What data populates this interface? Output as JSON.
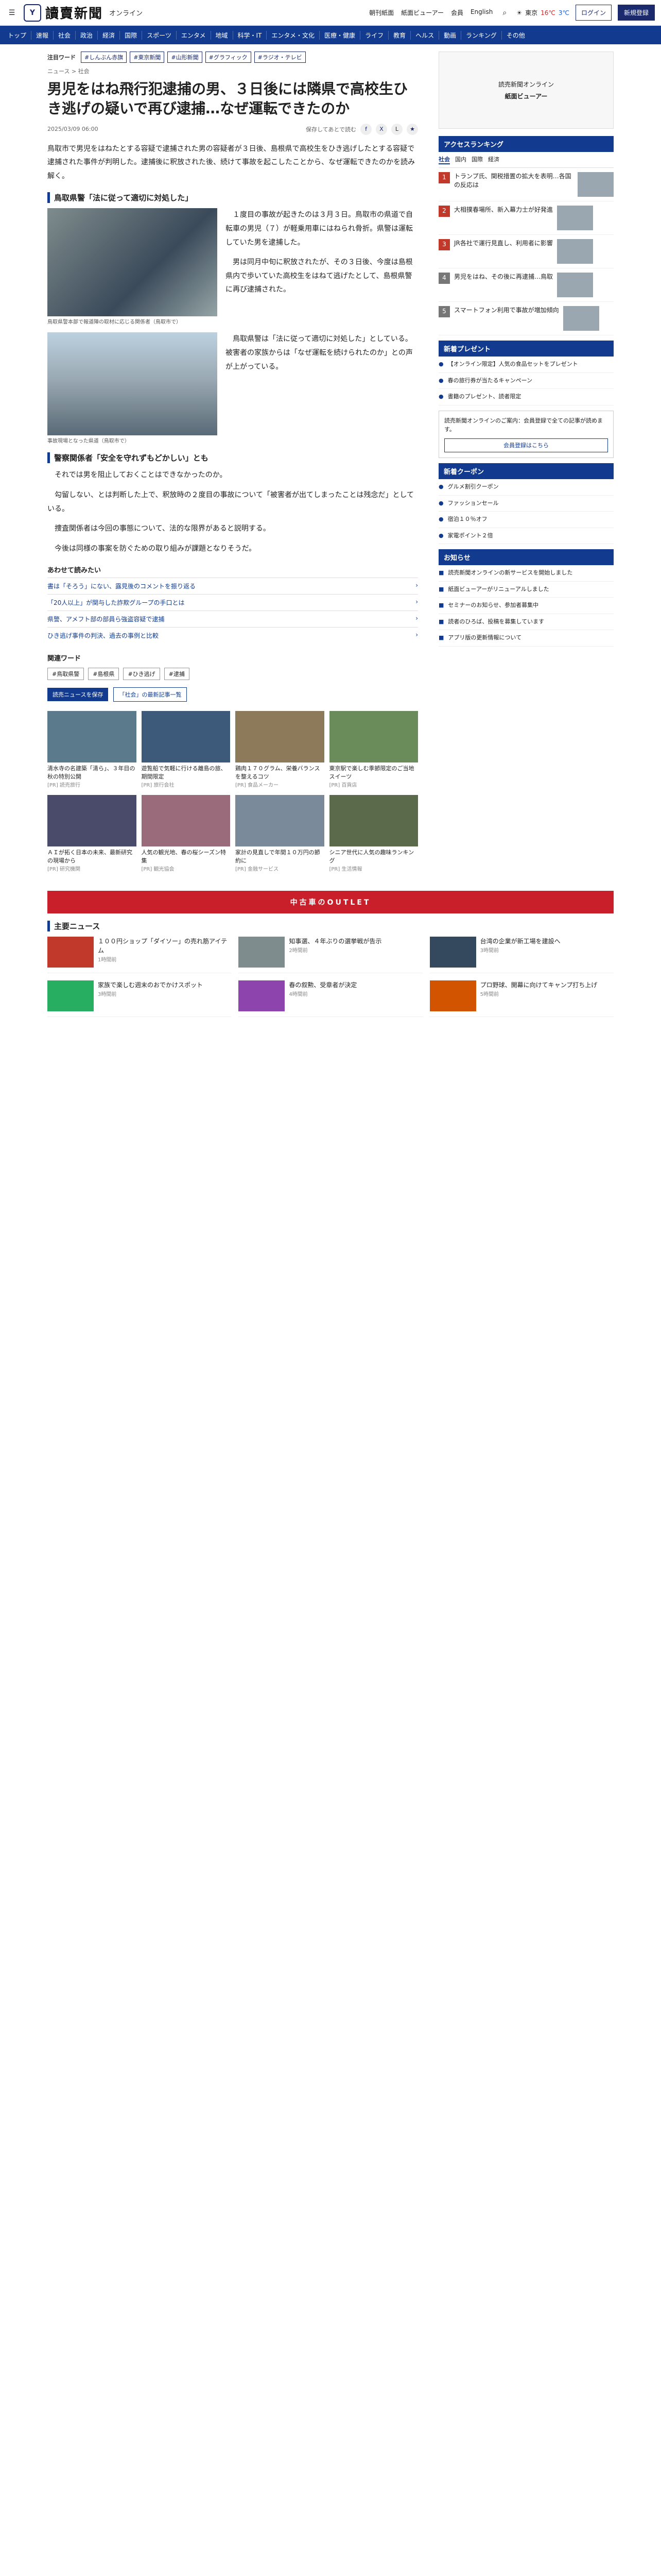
{
  "header": {
    "logo_mark": "Y",
    "logo_text": "讀賣新聞",
    "logo_sub": "オンライン",
    "util_links": [
      "朝刊紙面",
      "紙面ビューアー",
      "会員",
      "English"
    ],
    "weather": {
      "hi": "16℃",
      "lo": "3℃",
      "city": "東京"
    },
    "login": "ログイン",
    "register": "新規登録"
  },
  "nav": [
    "トップ",
    "速報",
    "社会",
    "政治",
    "経済",
    "国際",
    "スポーツ",
    "エンタメ",
    "地域",
    "科学・IT",
    "エンタメ・文化",
    "医療・健康",
    "ライフ",
    "教育",
    "ヘルス",
    "動画",
    "ランキング",
    "その他"
  ],
  "article": {
    "tags_label": "注目ワード",
    "tags": [
      "#しんぶん赤旗",
      "#東京新聞",
      "#山形新聞",
      "#グラフィック",
      "#ラジオ・テレビ"
    ],
    "crumb": "ニュース > 社会",
    "headline": "男児をはね飛行犯逮捕の男、３日後には隣県で高校生ひき逃げの疑いで再び逮捕…なぜ運転できたのか",
    "date": "2025/03/09 06:00",
    "share_label": "保存してあとで読む",
    "lead": "鳥取市で男児をはねたとする容疑で逮捕された男の容疑者が３日後、島根県で高校生をひき逃げしたとする容疑で逮捕された事件が判明した。逮捕後に釈放された後、続けて事故を起こしたことから、なぜ運転できたのかを読み解く。",
    "sections": [
      {
        "title": "鳥取県警「法に従って適切に対処した」",
        "paras": [
          "１度目の事故が起きたのは３月３日。鳥取市の県道で自転車の男児（７）が軽乗用車にはねられ骨折。県警は運転していた男を逮捕した。",
          "男は同月中旬に釈放されたが、その３日後、今度は島根県内で歩いていた高校生をはねて逃げたとして、島根県警に再び逮捕された。",
          "鳥取県警は「法に従って適切に対処した」としている。被害者の家族からは「なぜ運転を続けられたのか」との声が上がっている。"
        ]
      },
      {
        "title": "警察関係者「安全を守れずもどかしい」とも",
        "paras": [
          "それでは男を阻止しておくことはできなかったのか。",
          "勾留しない、とは判断した上で、釈放時の２度目の事故について「被害者が出てしまったことは残念だ」としている。",
          "捜査関係者は今回の事態について、法的な限界があると説明する。",
          "今後は同様の事案を防ぐための取り組みが課題となりそうだ。"
        ]
      }
    ],
    "fig1_caption": "鳥取県警本部で報道陣の取材に応じる関係者（鳥取市で）",
    "fig2_caption": "事故現場となった県道（鳥取市で）",
    "related_title": "あわせて読みたい",
    "related": [
      "書は「そろう」にない、露見後のコメントを振り返る",
      "「20人以上」が関与した詐欺グループの手口とは",
      "県警、アメフト部の部員ら強盗容疑で逮捕",
      "ひき逃げ事件の判決、過去の事例と比較"
    ],
    "kw_title": "関連ワード",
    "keywords": [
      "#鳥取県警",
      "#島根県",
      "#ひき逃げ",
      "#逮捕"
    ],
    "actions": {
      "save": "読売ニュースを保存",
      "follow": "「社会」の最新記事一覧"
    }
  },
  "promos": [
    {
      "title": "清水寺の名建築「清ら」、３年目の秋の特別公開",
      "src": "[PR] 読売旅行"
    },
    {
      "title": "遊覧船で気軽に行ける離島の旅、期間限定",
      "src": "[PR] 旅行会社"
    },
    {
      "title": "鶏肉１７０グラム、栄養バランスを整えるコツ",
      "src": "[PR] 食品メーカー"
    },
    {
      "title": "東京駅で楽しむ季節限定のご当地スイーツ",
      "src": "[PR] 百貨店"
    },
    {
      "title": "ＡＩが拓く日本の未来、最新研究の現場から",
      "src": "[PR] 研究機関"
    },
    {
      "title": "人気の観光地、春の桜シーズン特集",
      "src": "[PR] 観光協会"
    },
    {
      "title": "家計の見直しで年間１０万円の節約に",
      "src": "[PR] 金融サービス"
    },
    {
      "title": "シニア世代に人気の趣味ランキング",
      "src": "[PR] 生活情報"
    }
  ],
  "bottom_news": {
    "title": "主要ニュース",
    "banner": "中古車のOUTLET",
    "items": [
      {
        "title": "１００円ショップ「ダイソー」の売れ筋アイテム",
        "time": "1時間前"
      },
      {
        "title": "知事選、４年ぶりの選挙戦が告示",
        "time": "2時間前"
      },
      {
        "title": "台湾の企業が新工場を建設へ",
        "time": "3時間前"
      },
      {
        "title": "家族で楽しむ週末のおでかけスポット",
        "time": "3時間前"
      },
      {
        "title": "春の叙勲、受章者が決定",
        "time": "4時間前"
      },
      {
        "title": "プロ野球、開幕に向けてキャンプ打ち上げ",
        "time": "5時間前"
      }
    ]
  },
  "sidebar": {
    "ad_title": "読売新聞オンライン",
    "ad_sub": "紙面ビューアー",
    "ranking_title": "アクセスランキング",
    "ranking_tabs": [
      "社会",
      "国内",
      "国際",
      "経済"
    ],
    "ranking": [
      {
        "n": "1",
        "title": "トランプ氏、関税措置の拡大を表明…各国の反応は"
      },
      {
        "n": "2",
        "title": "大相撲春場所、新入幕力士が好発進"
      },
      {
        "n": "3",
        "title": "JR各社で運行見直し、利用者に影響"
      },
      {
        "n": "4",
        "title": "男児をはね、その後に再逮捕…鳥取"
      },
      {
        "n": "5",
        "title": "スマートフォン利用で事故が増加傾向"
      }
    ],
    "present_title": "新着プレゼント",
    "presents": [
      "【オンライン限定】人気の食品セットをプレゼント",
      "春の旅行券が当たるキャンペーン",
      "書籍のプレゼント、読者限定"
    ],
    "notice": "読売新聞オンラインのご案内：会員登録で全ての記事が読めます。",
    "notice_btn": "会員登録はこちら",
    "coupon_title": "新着クーポン",
    "coupons": [
      "グルメ割引クーポン",
      "ファッションセール",
      "宿泊１０％オフ",
      "家電ポイント２倍"
    ],
    "list_title": "お知らせ",
    "list": [
      "読売新聞オンラインの新サービスを開始しました",
      "紙面ビューアーがリニューアルしました",
      "セミナーのお知らせ、参加者募集中",
      "読者のひろば、投稿を募集しています",
      "アプリ版の更新情報について"
    ]
  }
}
